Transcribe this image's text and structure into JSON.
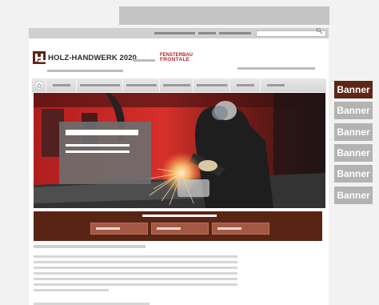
{
  "header": {
    "logo_text": "HOLZ-HANDWERK 2020",
    "partner_logo_line1": "FENSTERBAU",
    "partner_logo_line2": "FRONTALE",
    "logo_color": "#5e2615",
    "partner_color": "#b3242a"
  },
  "icons": {
    "search": "search-icon",
    "home": "home-icon"
  },
  "colors": {
    "accent_dark": "#5e2615",
    "cta_background": "#5a2415",
    "cta_button": "#a35843",
    "placeholder_gray": "#c4c4c4"
  },
  "banners": [
    {
      "label": "Banner",
      "active": true
    },
    {
      "label": "Banner",
      "active": false
    },
    {
      "label": "Banner",
      "active": false
    },
    {
      "label": "Banner",
      "active": false
    },
    {
      "label": "Banner",
      "active": false
    },
    {
      "label": "Banner",
      "active": false
    }
  ]
}
